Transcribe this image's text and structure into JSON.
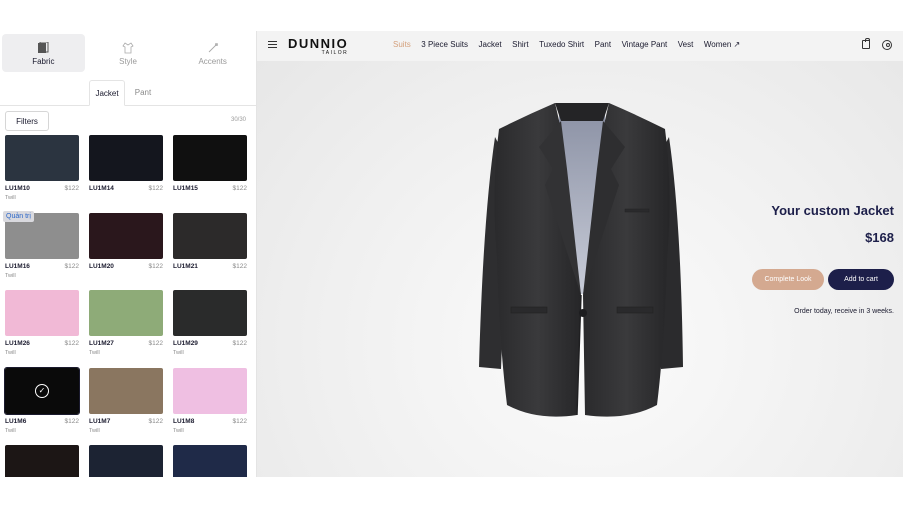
{
  "sidebar": {
    "modes": [
      {
        "label": "Fabric",
        "icon": "fabric-roll-icon",
        "active": true
      },
      {
        "label": "Style",
        "icon": "shirt-style-icon",
        "active": false
      },
      {
        "label": "Accents",
        "icon": "needle-accents-icon",
        "active": false
      }
    ],
    "tabs": [
      {
        "label": "Jacket",
        "active": true
      },
      {
        "label": "Pant",
        "active": false
      }
    ],
    "filters_label": "Filters",
    "count": "30/30",
    "admin_tag": "Quản trị",
    "fabrics": [
      {
        "code": "LU1M10",
        "price": "$122",
        "weave": "Twill",
        "color": "#2b3440"
      },
      {
        "code": "LU1M14",
        "price": "$122",
        "weave": "",
        "color": "#14161e"
      },
      {
        "code": "LU1M15",
        "price": "$122",
        "weave": "",
        "color": "#101010"
      },
      {
        "code": "LU1M16",
        "price": "$122",
        "weave": "Twill",
        "color": "#8e8e8e"
      },
      {
        "code": "LU1M20",
        "price": "$122",
        "weave": "",
        "color": "#2a171c"
      },
      {
        "code": "LU1M21",
        "price": "$122",
        "weave": "",
        "color": "#2c2a2a"
      },
      {
        "code": "LU1M26",
        "price": "$122",
        "weave": "Twill",
        "color": "#f1b9d6"
      },
      {
        "code": "LU1M27",
        "price": "$122",
        "weave": "Twill",
        "color": "#8eab78"
      },
      {
        "code": "LU1M29",
        "price": "$122",
        "weave": "Twill",
        "color": "#2a2b2b"
      },
      {
        "code": "LU1M6",
        "price": "$122",
        "weave": "Twill",
        "color": "#0a0a0a",
        "selected": true
      },
      {
        "code": "LU1M7",
        "price": "$122",
        "weave": "Twill",
        "color": "#8a7660"
      },
      {
        "code": "LU1M8",
        "price": "$122",
        "weave": "Twill",
        "color": "#efbfe2"
      },
      {
        "code": "",
        "price": "",
        "weave": "",
        "color": "#1c1615"
      },
      {
        "code": "",
        "price": "",
        "weave": "",
        "color": "#1c2333"
      },
      {
        "code": "",
        "price": "",
        "weave": "",
        "color": "#1f2a48"
      }
    ]
  },
  "header": {
    "logo_main": "DUNNIO",
    "logo_sub": "TAILOR",
    "menu": [
      {
        "label": "Suits",
        "selected": true
      },
      {
        "label": "3 Piece Suits"
      },
      {
        "label": "Jacket"
      },
      {
        "label": "Shirt"
      },
      {
        "label": "Tuxedo Shirt"
      },
      {
        "label": "Pant"
      },
      {
        "label": "Vintage Pant"
      },
      {
        "label": "Vest"
      },
      {
        "label": "Women ↗"
      }
    ]
  },
  "product": {
    "title": "Your custom Jacket",
    "price": "$168",
    "complete_look_label": "Complete Look",
    "add_to_cart_label": "Add to cart",
    "delivery_note": "Order today, receive in 3 weeks."
  },
  "colors": {
    "accent_selected_menu": "#d4a07c",
    "navy": "#1d1f4a",
    "complete_look": "#d4a990"
  }
}
